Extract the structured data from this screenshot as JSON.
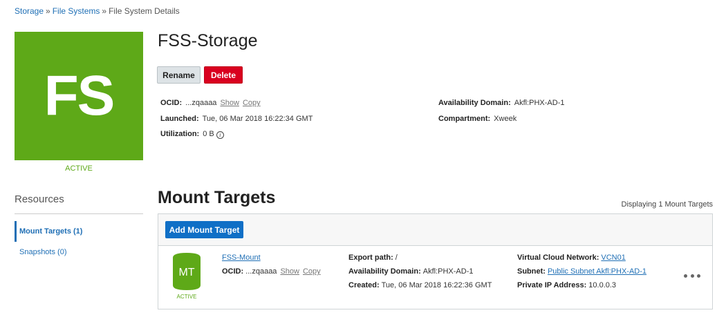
{
  "breadcrumb": {
    "items": [
      "Storage",
      "File Systems",
      "File System Details"
    ],
    "separator": "»"
  },
  "file_system": {
    "icon_text": "FS",
    "status": "ACTIVE",
    "name": "FSS-Storage",
    "actions": {
      "rename": "Rename",
      "delete": "Delete"
    },
    "details": {
      "ocid_label": "OCID:",
      "ocid_value": "...zqaaaa",
      "show": "Show",
      "copy": "Copy",
      "launched_label": "Launched:",
      "launched_value": "Tue, 06 Mar 2018 16:22:34 GMT",
      "utilization_label": "Utilization:",
      "utilization_value": "0 B",
      "availability_domain_label": "Availability Domain:",
      "availability_domain_value": "Akfl:PHX-AD-1",
      "compartment_label": "Compartment:",
      "compartment_value": "Xweek"
    }
  },
  "resources": {
    "title": "Resources",
    "items": [
      {
        "label": "Mount Targets (1)",
        "active": true
      },
      {
        "label": "Snapshots (0)",
        "active": false
      }
    ]
  },
  "mount_targets": {
    "title": "Mount Targets",
    "count_text": "Displaying 1 Mount Targets",
    "add_button": "Add Mount Target",
    "rows": [
      {
        "icon_text": "MT",
        "status": "ACTIVE",
        "name": "FSS-Mount",
        "ocid_label": "OCID:",
        "ocid_value": "...zqaaaa",
        "show": "Show",
        "copy": "Copy",
        "export_path_label": "Export path:",
        "export_path_value": "/",
        "availability_domain_label": "Availability Domain:",
        "availability_domain_value": "Akfl:PHX-AD-1",
        "created_label": "Created:",
        "created_value": "Tue, 06 Mar 2018 16:22:36 GMT",
        "vcn_label": "Virtual Cloud Network:",
        "vcn_value": "VCN01",
        "subnet_label": "Subnet:",
        "subnet_value": "Public Subnet Akfl:PHX-AD-1",
        "private_ip_label": "Private IP Address:",
        "private_ip_value": "10.0.0.3"
      }
    ]
  },
  "colors": {
    "active_green": "#5ea918",
    "link_blue": "#1f6fb5",
    "primary_button": "#0f6fc6",
    "delete_red": "#d9001f"
  }
}
